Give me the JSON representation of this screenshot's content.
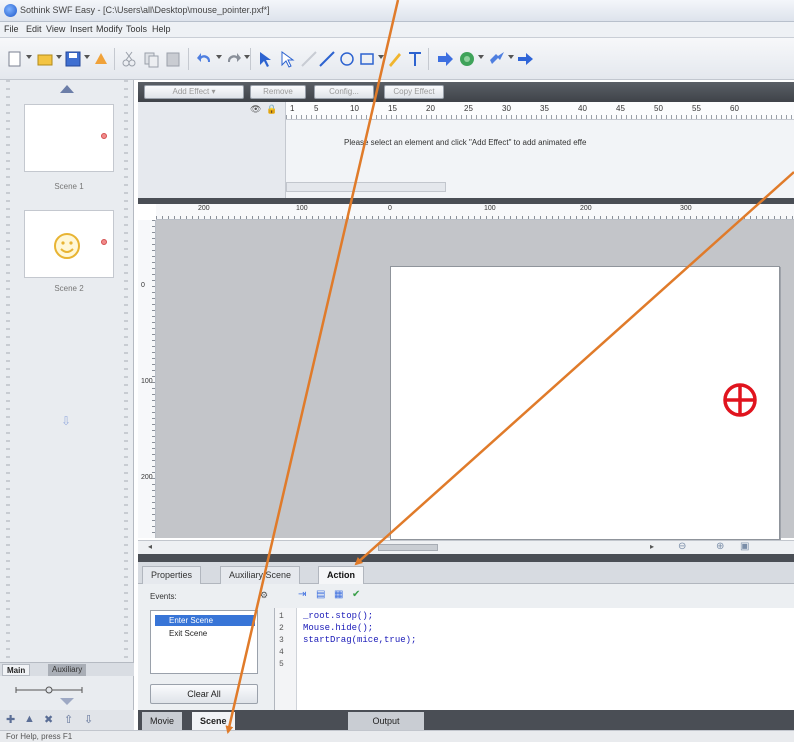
{
  "window": {
    "title": "Sothink SWF Easy - [C:\\Users\\all\\Desktop\\mouse_pointer.pxf*]"
  },
  "menu": [
    "File",
    "Edit",
    "View",
    "Insert",
    "Modify",
    "Tools",
    "Help"
  ],
  "toolbar": {
    "icons": [
      "new-icon",
      "open-icon",
      "save-icon",
      "publish-icon",
      "cut-icon",
      "copy-icon",
      "paste-icon",
      "undo-icon",
      "redo-icon",
      "select-tool-icon",
      "subselect-tool-icon",
      "line-tool-icon",
      "curve-tool-icon",
      "oval-tool-icon",
      "rectangle-tool-icon",
      "pencil-tool-icon",
      "text-tool-icon",
      "play-icon",
      "browser-preview-icon",
      "export-icon",
      "test-icon"
    ]
  },
  "scenes": {
    "items": [
      {
        "label": "Scene 1"
      },
      {
        "label": "Scene 2"
      }
    ]
  },
  "left_panel": {
    "tabs": [
      "Main",
      "Auxiliary"
    ],
    "active_tab": "Main"
  },
  "effects": {
    "buttons": {
      "add_effect": "Add Effect",
      "remove": "Remove",
      "config": "Config...",
      "copy_effect": "Copy Effect"
    },
    "ruler_labels": [
      "1",
      "5",
      "10",
      "15",
      "20",
      "25",
      "30",
      "35",
      "40",
      "45",
      "50",
      "55",
      "60"
    ],
    "hint": "Please select an element and click \"Add Effect\" to add animated effe"
  },
  "stage": {
    "h_ruler_labels": [
      "200",
      "100",
      "0",
      "100",
      "200",
      "300"
    ],
    "v_ruler_labels": [
      "0",
      "100",
      "200"
    ],
    "canvas_object": "crosshair-cursor",
    "accent_color": "#e0141e"
  },
  "bottom_tabs": {
    "items": [
      "Properties",
      "Auxiliary Scene",
      "Action"
    ],
    "active": "Action"
  },
  "action_panel": {
    "events_label": "Events:",
    "events": [
      "Enter Scene",
      "Exit Scene"
    ],
    "selected_event": "Enter Scene",
    "clear_all": "Clear All",
    "code_lines": [
      "_root.stop();",
      "Mouse.hide();",
      "startDrag(mice,true);",
      "",
      ""
    ],
    "line_numbers": [
      "1",
      "2",
      "3",
      "4",
      "5"
    ]
  },
  "dock_tabs": {
    "items": [
      "Movie",
      "Scene",
      "Output"
    ],
    "active": "Scene"
  },
  "status": {
    "text": "For Help, press F1"
  },
  "annotation": {
    "arrow_color": "#e07b2a"
  }
}
